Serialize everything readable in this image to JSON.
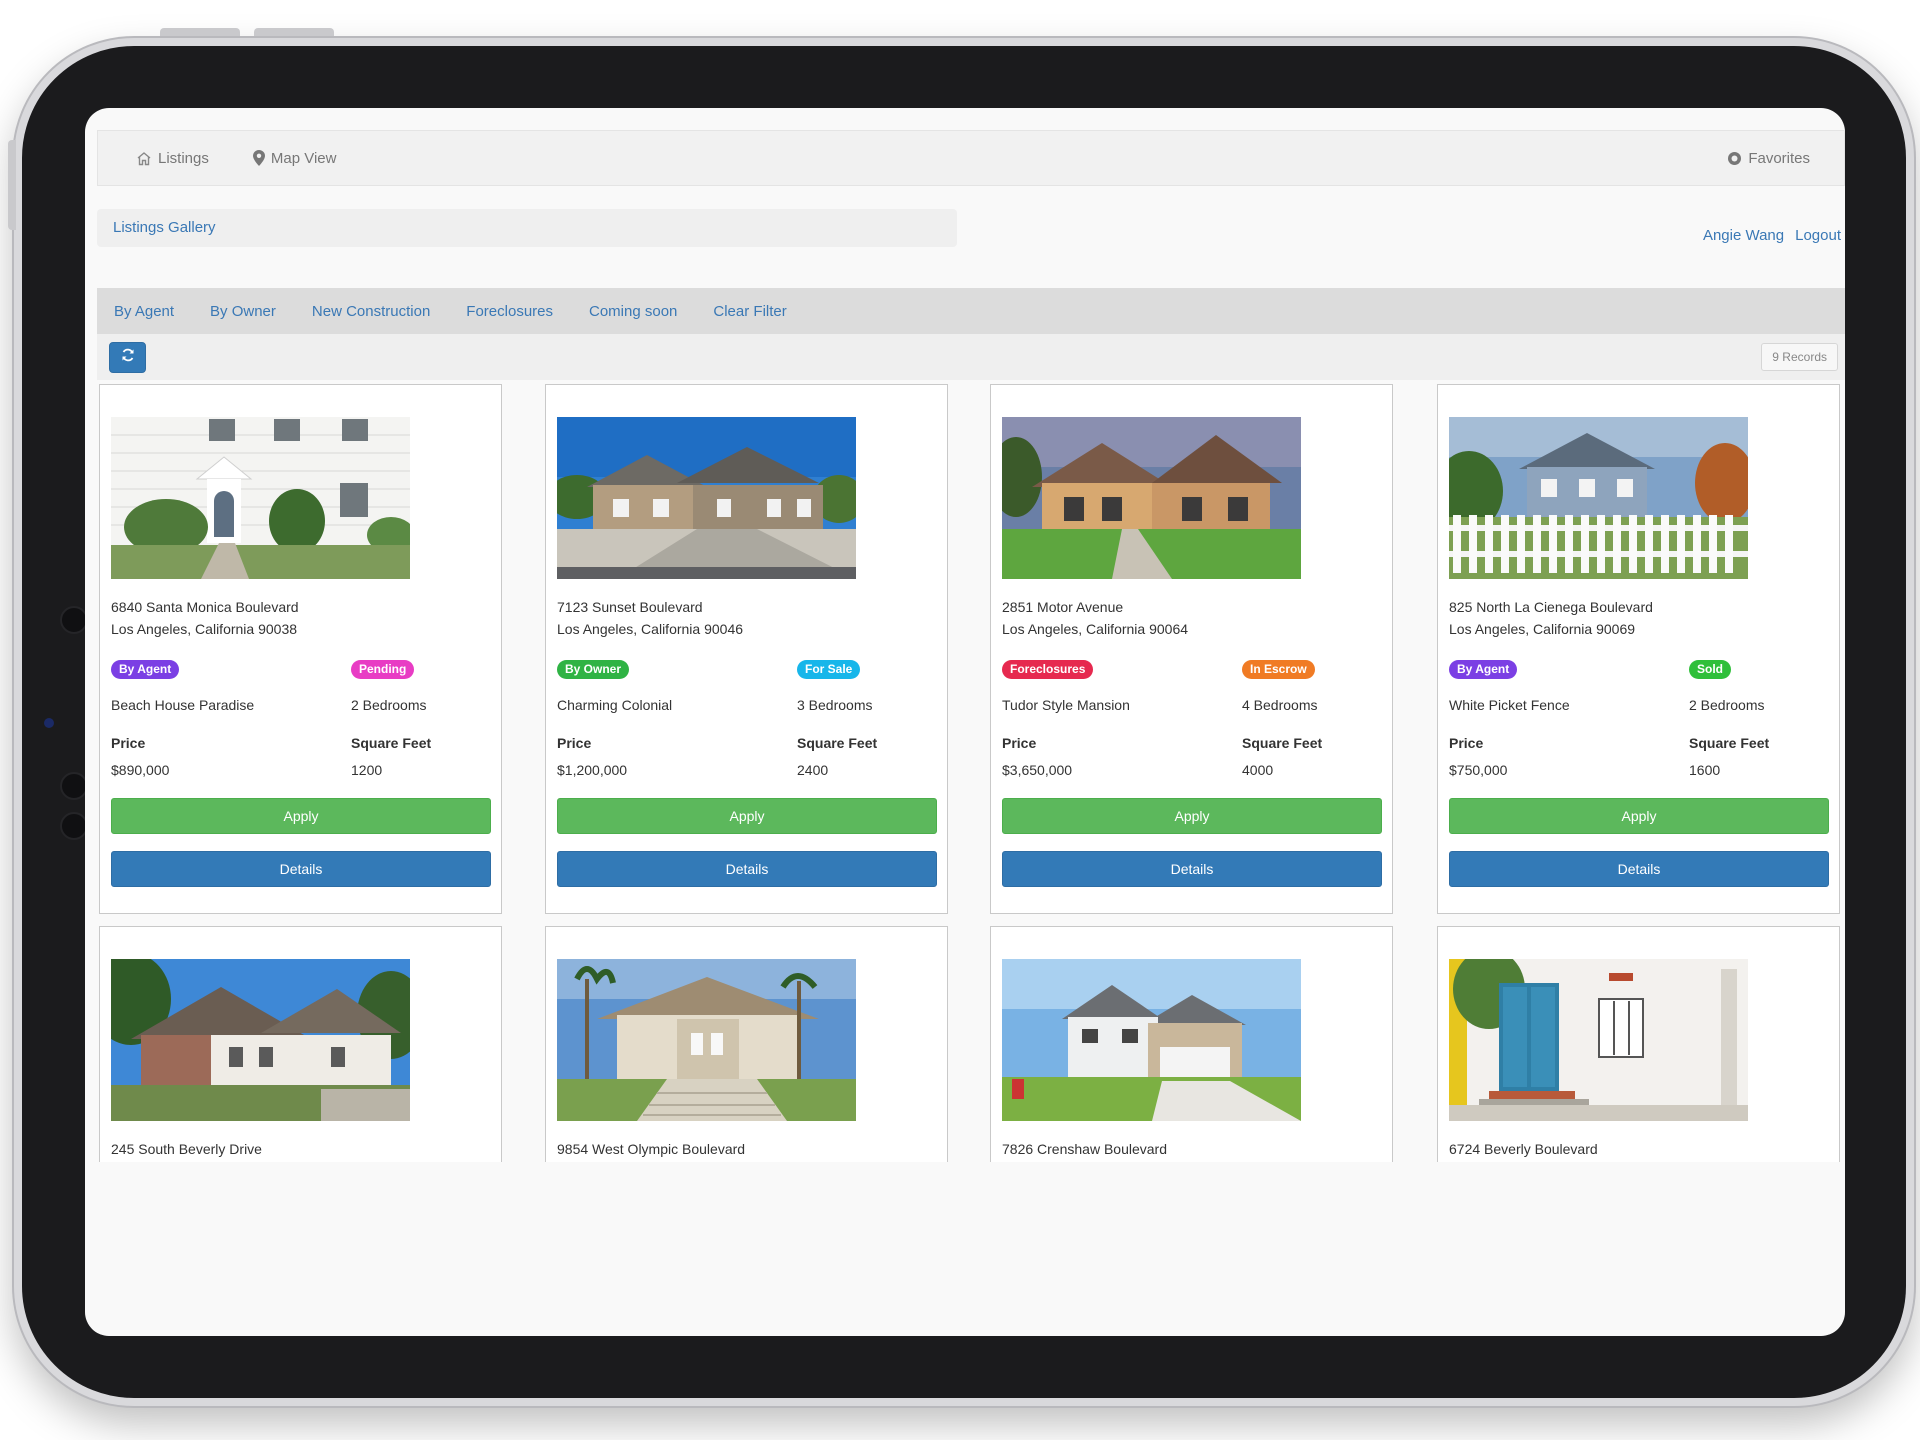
{
  "navbar": {
    "listings_label": "Listings",
    "map_view_label": "Map View",
    "favorites_label": "Favorites"
  },
  "breadcrumb": {
    "label": "Listings Gallery"
  },
  "user": {
    "name": "Angie Wang",
    "logout_label": "Logout"
  },
  "filters": [
    "By Agent",
    "By Owner",
    "New Construction",
    "Foreclosures",
    "Coming soon",
    "Clear Filter"
  ],
  "toolbar": {
    "records_label": "9 Records"
  },
  "labels": {
    "price": "Price",
    "square_feet": "Square Feet",
    "apply": "Apply",
    "details": "Details"
  },
  "badge_colors": {
    "By Agent": "#7b3fe4",
    "By Owner": "#2fb344",
    "Foreclosures": "#e6294f",
    "Pending": "#e83cc4",
    "For Sale": "#17b6ea",
    "In Escrow": "#f07b24",
    "Sold": "#2fbf3a"
  },
  "listings": [
    {
      "address_line1": "6840 Santa Monica Boulevard",
      "address_line2": "Los Angeles, California 90038",
      "type_badge": "By Agent",
      "status_badge": "Pending",
      "title": "Beach House Paradise",
      "bedrooms": "2 Bedrooms",
      "price": "$890,000",
      "square_feet": "1200"
    },
    {
      "address_line1": "7123 Sunset Boulevard",
      "address_line2": "Los Angeles, California 90046",
      "type_badge": "By Owner",
      "status_badge": "For Sale",
      "title": "Charming Colonial",
      "bedrooms": "3 Bedrooms",
      "price": "$1,200,000",
      "square_feet": "2400"
    },
    {
      "address_line1": "2851 Motor Avenue",
      "address_line2": "Los Angeles, California 90064",
      "type_badge": "Foreclosures",
      "status_badge": "In Escrow",
      "title": "Tudor Style Mansion",
      "bedrooms": "4 Bedrooms",
      "price": "$3,650,000",
      "square_feet": "4000"
    },
    {
      "address_line1": "825 North La Cienega Boulevard",
      "address_line2": "Los Angeles, California 90069",
      "type_badge": "By Agent",
      "status_badge": "Sold",
      "title": "White Picket Fence",
      "bedrooms": "2 Bedrooms",
      "price": "$750,000",
      "square_feet": "1600"
    },
    {
      "address_line1": "245 South Beverly Drive"
    },
    {
      "address_line1": "9854 West Olympic Boulevard"
    },
    {
      "address_line1": "7826 Crenshaw Boulevard"
    },
    {
      "address_line1": "6724 Beverly Boulevard"
    }
  ]
}
